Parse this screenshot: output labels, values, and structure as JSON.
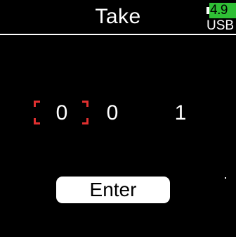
{
  "header": {
    "title": "Take"
  },
  "battery": {
    "voltage": "4.9",
    "source": "USB",
    "color": "#2fbf35",
    "icon": "battery-icon"
  },
  "take_number": {
    "digits": [
      "0",
      "0",
      "1"
    ],
    "selected_index": 0,
    "selection_color": "#e03030"
  },
  "enter_button": {
    "label": "Enter"
  },
  "colors": {
    "background": "#000000",
    "foreground": "#ffffff"
  }
}
